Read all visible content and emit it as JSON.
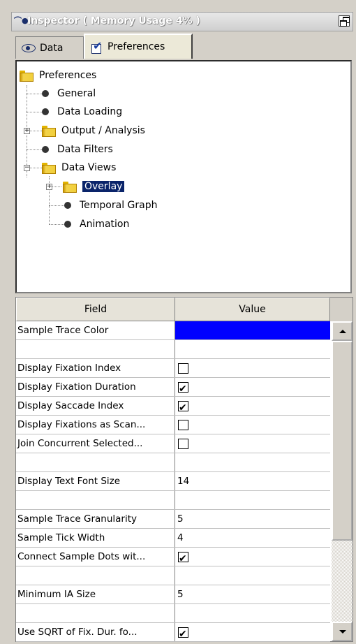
{
  "window": {
    "title": "Inspector ( Memory Usage 4% )",
    "icon": "inspector-eye-icon"
  },
  "tabs": [
    {
      "label": "Data",
      "icon": "eye-icon",
      "active": false
    },
    {
      "label": "Preferences",
      "icon": "checkbox-icon",
      "active": true
    }
  ],
  "tree": {
    "root": "Preferences",
    "items": [
      {
        "label": "General"
      },
      {
        "label": "Data Loading"
      },
      {
        "label": "Output / Analysis"
      },
      {
        "label": "Data Filters"
      },
      {
        "label": "Data Views"
      },
      {
        "label": "Overlay",
        "selected": true
      },
      {
        "label": "Temporal Graph"
      },
      {
        "label": "Animation"
      }
    ]
  },
  "grid": {
    "headers": {
      "field": "Field",
      "value": "Value"
    },
    "rows": [
      {
        "field": "Sample Trace Color",
        "type": "color",
        "value": "#0000ff"
      },
      {
        "field": "",
        "type": "empty",
        "value": ""
      },
      {
        "field": "Display Fixation Index",
        "type": "checkbox",
        "checked": false
      },
      {
        "field": "Display Fixation Duration",
        "type": "checkbox",
        "checked": true
      },
      {
        "field": "Display Saccade Index",
        "type": "checkbox",
        "checked": true
      },
      {
        "field": "Display Fixations as Scan...",
        "type": "checkbox",
        "checked": false
      },
      {
        "field": "Join Concurrent Selected...",
        "type": "checkbox",
        "checked": false
      },
      {
        "field": "",
        "type": "empty",
        "value": ""
      },
      {
        "field": "Display Text Font Size",
        "type": "text",
        "value": "14"
      },
      {
        "field": "",
        "type": "empty",
        "value": ""
      },
      {
        "field": "Sample Trace Granularity",
        "type": "text",
        "value": "5"
      },
      {
        "field": "Sample Tick Width",
        "type": "text",
        "value": "4"
      },
      {
        "field": "Connect Sample Dots wit...",
        "type": "checkbox",
        "checked": true
      },
      {
        "field": "",
        "type": "empty",
        "value": ""
      },
      {
        "field": "Minimum IA Size",
        "type": "text",
        "value": "5"
      },
      {
        "field": "",
        "type": "empty",
        "value": ""
      },
      {
        "field": "Use SQRT of Fix. Dur. fo...",
        "type": "checkbox",
        "checked": true
      }
    ]
  }
}
